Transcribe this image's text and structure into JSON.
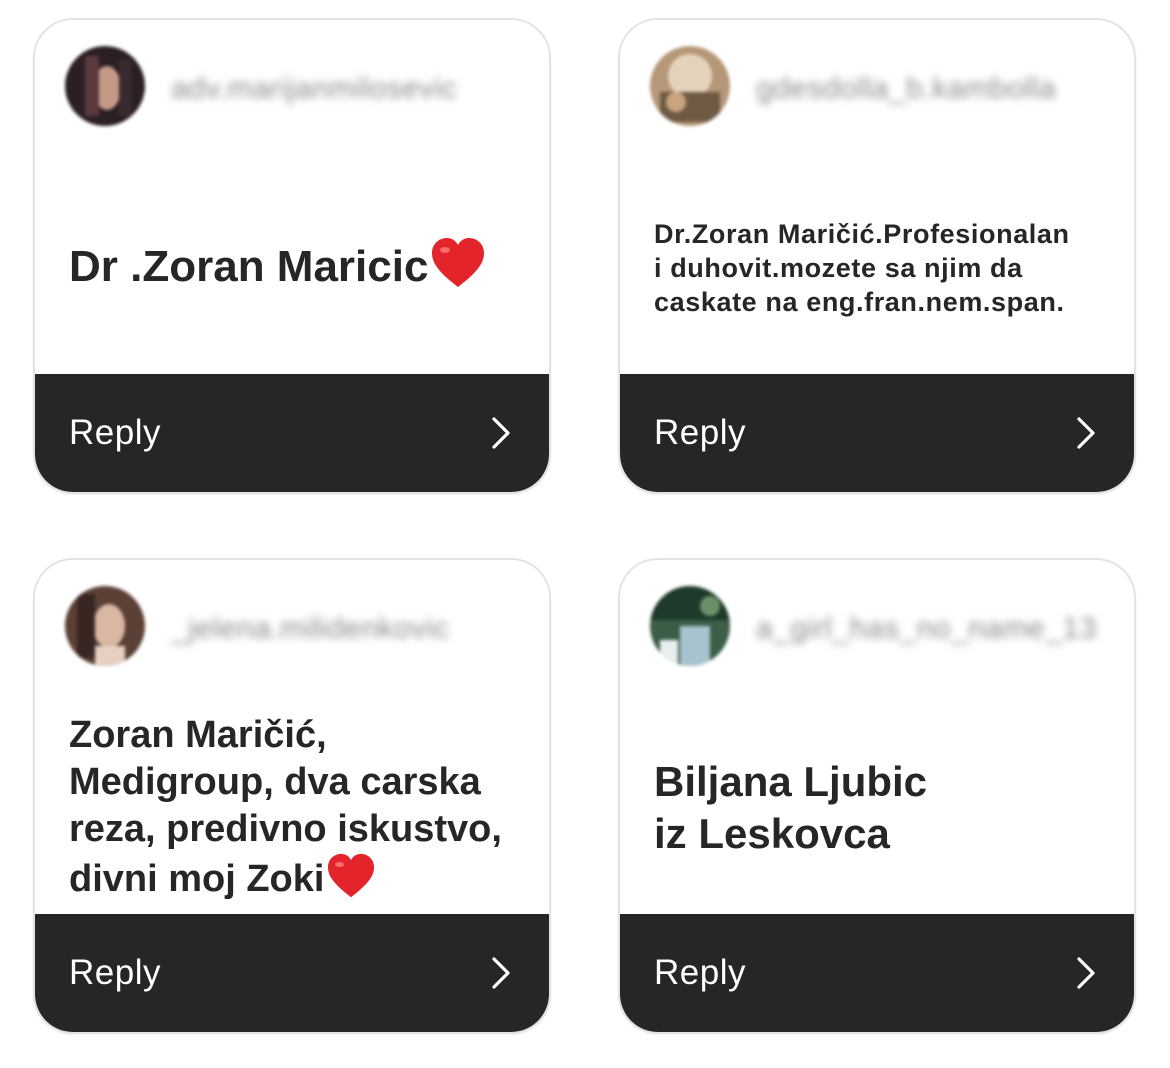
{
  "cards": [
    {
      "username": "adv.marijanmilosevic",
      "text": "Dr .Zoran Maricic",
      "emoji": "heart-emoji",
      "reply_label": "Reply",
      "avatar_colors": [
        "#2b1f25",
        "#c49a86",
        "#5a3a3e"
      ]
    },
    {
      "username": "gdesdolla_b.kambolla",
      "text": "Dr.Zoran Maričić.Profesionalan\ni duhovit.mozete sa njim da\ncaskate na eng.fran.nem.span.",
      "reply_label": "Reply",
      "avatar_colors": [
        "#b59878",
        "#e4d4bc",
        "#6f5a43"
      ]
    },
    {
      "username": "_jelena.milidenkovic",
      "text": "Zoran Maričić,\nMedigroup, dva carska\nreza, predivno iskustvo,\ndivni moj Zoki",
      "emoji": "heart-emoji",
      "reply_label": "Reply",
      "avatar_colors": [
        "#5b4036",
        "#d9b7a3",
        "#382622"
      ]
    },
    {
      "username": "a_girl_has_no_name_13",
      "text": "Biljana Ljubic\niz Leskovca",
      "reply_label": "Reply",
      "avatar_colors": [
        "#3c5e47",
        "#a6c3cf",
        "#1f3a2a"
      ]
    }
  ],
  "colors": {
    "footer_bg": "#262626",
    "body_text": "#262626",
    "heart": "#e3242b"
  }
}
